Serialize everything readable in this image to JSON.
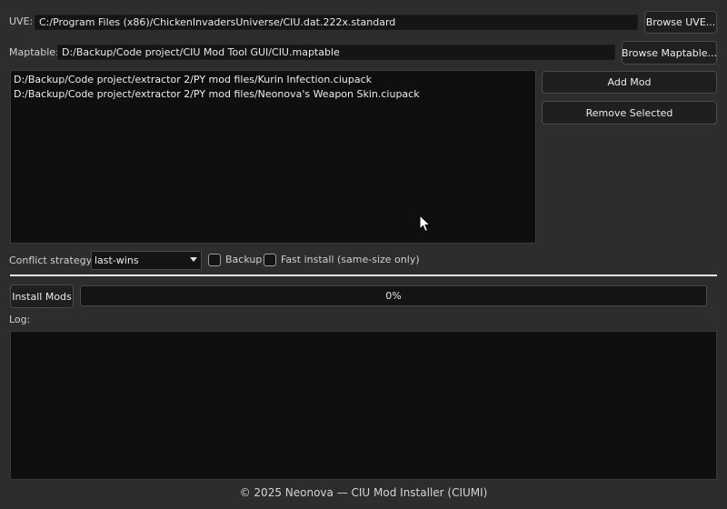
{
  "uve": {
    "label": "UVE:",
    "value": "C:/Program Files (x86)/ChickenInvadersUniverse/CIU.dat.222x.standard",
    "browse_label": "Browse UVE..."
  },
  "maptable": {
    "label": "Maptable:",
    "value": "D:/Backup/Code project/CIU Mod Tool GUI/CIU.maptable",
    "browse_label": "Browse Maptable..."
  },
  "mod_list": {
    "items": [
      "D:/Backup/Code project/extractor 2/PY mod files/Kurin Infection.ciupack",
      "D:/Backup/Code project/extractor 2/PY mod files/Neonova's Weapon Skin.ciupack"
    ]
  },
  "actions": {
    "add_mod_label": "Add Mod",
    "remove_selected_label": "Remove Selected"
  },
  "options": {
    "conflict_label": "Conflict strategy:",
    "conflict_value": "last-wins",
    "backup_label": "Backup",
    "backup_checked": false,
    "fast_install_label": "Fast install (same-size only)",
    "fast_install_checked": false
  },
  "install": {
    "button_label": "Install Mods",
    "progress_percent": 0,
    "progress_text": "0%"
  },
  "log": {
    "label": "Log:"
  },
  "footer": {
    "text": "© 2025 Neonova — CIU Mod Installer (CIUMI)"
  },
  "colors": {
    "window_bg": "#2d2d2d",
    "field_bg": "#151515",
    "list_bg": "#0f0f0f",
    "button_border": "#4a4a4a",
    "progress_accent": "#2a82da"
  },
  "icons": {
    "cursor": "mouse-pointer-icon",
    "combo_arrow": "chevron-down-icon"
  }
}
